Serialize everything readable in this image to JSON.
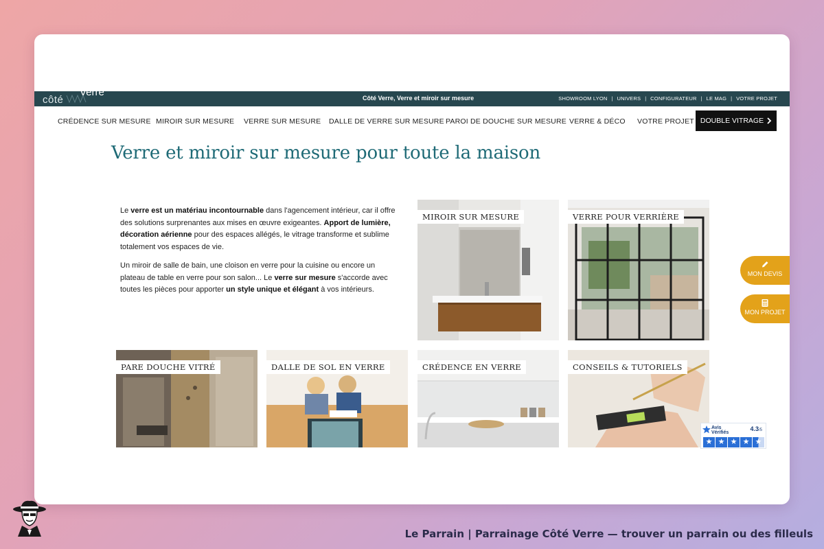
{
  "topbar": {
    "logo_text_1": "côté",
    "logo_text_2": "Verre",
    "tagline": "Côté Verre, Verre et miroir sur mesure",
    "links": [
      "SHOWROOM LYON",
      "UNIVERS",
      "CONFIGURATEUR",
      "LE MAG",
      "VOTRE PROJET"
    ],
    "separator": "|"
  },
  "nav": {
    "items": [
      "CRÉDENCE SUR MESURE",
      "MIROIR SUR MESURE",
      "VERRE SUR MESURE",
      "DALLE DE VERRE SUR MESURE",
      "PAROI DE DOUCHE SUR MESURE",
      "VERRE & DÉCO",
      "VOTRE PROJET"
    ],
    "cta": "DOUBLE VITRAGE",
    "cta_icon": "chevron-right-icon"
  },
  "page": {
    "title": "Verre et miroir sur mesure pour toute la maison"
  },
  "intro": {
    "p1_a": "Le ",
    "p1_b": "verre est un matériau incontournable",
    "p1_c": " dans l'agencement intérieur, car il offre des solutions surprenantes aux mises en œuvre exigeantes. ",
    "p1_d": "Apport de lumière, décoration aérienne",
    "p1_e": " pour des espaces allégés, le vitrage transforme et sublime totalement vos espaces de vie.",
    "p2_a": "Un miroir de salle de bain, une cloison en verre pour la cuisine ou encore un plateau de table en verre pour son salon... Le ",
    "p2_b": "verre sur mesure",
    "p2_c": " s'accorde avec toutes les pièces pour apporter ",
    "p2_d": "un style unique et élégant",
    "p2_e": " à vos intérieurs."
  },
  "tiles": {
    "miroir": "MIROIR SUR MESURE",
    "verriere": "VERRE POUR VERRIÈRE",
    "douche": "PARE DOUCHE VITRÉ",
    "dalle": "DALLE DE SOL EN VERRE",
    "credence": "CRÉDENCE EN VERRE",
    "conseils": "CONSEILS & TUTORIELS"
  },
  "side_buttons": {
    "devis": "MON DEVIS",
    "devis_icon": "pencil-icon",
    "projet": "MON PROJET",
    "projet_icon": "calculator-icon"
  },
  "avis": {
    "brand_1": "Avis",
    "brand_2": "Vérifiés",
    "score": "4.3",
    "out_of": "/5",
    "rating": 4.3
  },
  "footer": {
    "title": "Le Parrain | Parrainage Côté Verre — trouver un parrain ou des filleuls"
  },
  "colors": {
    "topbar": "#27474f",
    "title": "#1e6a76",
    "cta": "#111111",
    "side_button": "#e3a21a",
    "avis_blue": "#2a6fd6"
  }
}
